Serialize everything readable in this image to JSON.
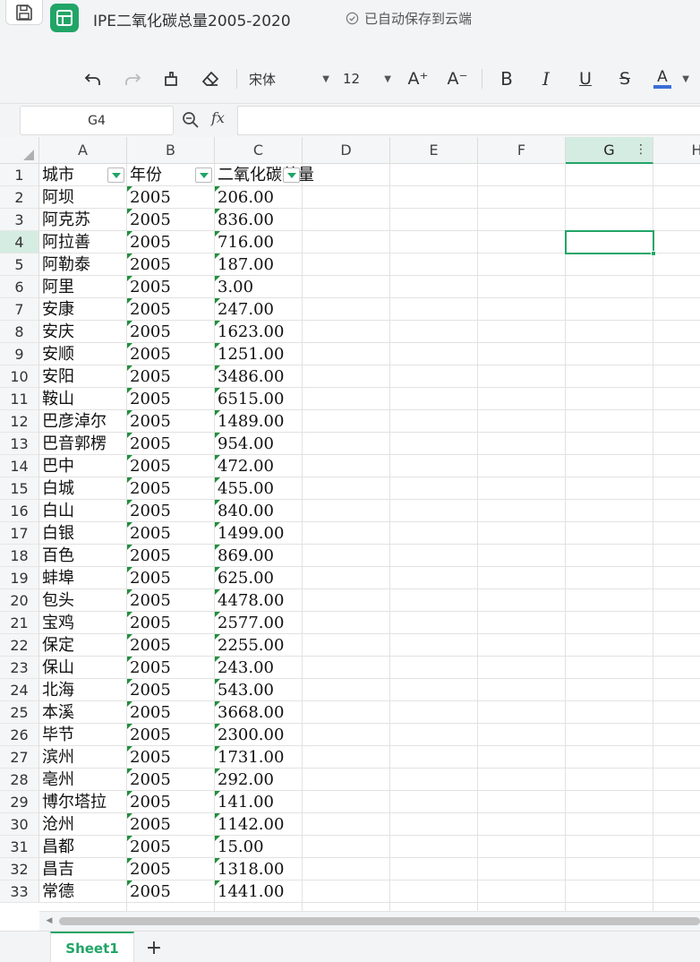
{
  "title_bar": {
    "doc_title": "IPE二氧化碳总量2005-2020",
    "save_status": "已自动保存到云端",
    "save_icon": "save-icon",
    "app_icon": "spreadsheet-app-icon"
  },
  "toolbar": {
    "font_name": "宋体",
    "font_size": "12",
    "increase_font": "A⁺",
    "decrease_font": "A⁻",
    "bold": "B",
    "italic": "I",
    "underline": "U",
    "strike": "S",
    "font_color": "A",
    "font_color_value": "#3a6fd8"
  },
  "formula_bar": {
    "cell_ref": "G4",
    "fx": "fx",
    "formula": ""
  },
  "grid": {
    "columns": [
      "A",
      "B",
      "C",
      "D",
      "E",
      "F",
      "G",
      "H"
    ],
    "active_column": "G",
    "active_row": 4,
    "header_row": [
      "城市",
      "年份",
      "二氧化碳总量"
    ],
    "rows": [
      {
        "row": "2",
        "city": "阿坝",
        "year": "2005",
        "co2": "206.00"
      },
      {
        "row": "3",
        "city": "阿克苏",
        "year": "2005",
        "co2": "836.00"
      },
      {
        "row": "4",
        "city": "阿拉善",
        "year": "2005",
        "co2": "716.00"
      },
      {
        "row": "5",
        "city": "阿勒泰",
        "year": "2005",
        "co2": "187.00"
      },
      {
        "row": "6",
        "city": "阿里",
        "year": "2005",
        "co2": "3.00"
      },
      {
        "row": "7",
        "city": "安康",
        "year": "2005",
        "co2": "247.00"
      },
      {
        "row": "8",
        "city": "安庆",
        "year": "2005",
        "co2": "1623.00"
      },
      {
        "row": "9",
        "city": "安顺",
        "year": "2005",
        "co2": "1251.00"
      },
      {
        "row": "10",
        "city": "安阳",
        "year": "2005",
        "co2": "3486.00"
      },
      {
        "row": "11",
        "city": "鞍山",
        "year": "2005",
        "co2": "6515.00"
      },
      {
        "row": "12",
        "city": "巴彦淖尔",
        "year": "2005",
        "co2": "1489.00"
      },
      {
        "row": "13",
        "city": "巴音郭楞",
        "year": "2005",
        "co2": "954.00"
      },
      {
        "row": "14",
        "city": "巴中",
        "year": "2005",
        "co2": "472.00"
      },
      {
        "row": "15",
        "city": "白城",
        "year": "2005",
        "co2": "455.00"
      },
      {
        "row": "16",
        "city": "白山",
        "year": "2005",
        "co2": "840.00"
      },
      {
        "row": "17",
        "city": "白银",
        "year": "2005",
        "co2": "1499.00"
      },
      {
        "row": "18",
        "city": "百色",
        "year": "2005",
        "co2": "869.00"
      },
      {
        "row": "19",
        "city": "蚌埠",
        "year": "2005",
        "co2": "625.00"
      },
      {
        "row": "20",
        "city": "包头",
        "year": "2005",
        "co2": "4478.00"
      },
      {
        "row": "21",
        "city": "宝鸡",
        "year": "2005",
        "co2": "2577.00"
      },
      {
        "row": "22",
        "city": "保定",
        "year": "2005",
        "co2": "2255.00"
      },
      {
        "row": "23",
        "city": "保山",
        "year": "2005",
        "co2": "243.00"
      },
      {
        "row": "24",
        "city": "北海",
        "year": "2005",
        "co2": "543.00"
      },
      {
        "row": "25",
        "city": "本溪",
        "year": "2005",
        "co2": "3668.00"
      },
      {
        "row": "26",
        "city": "毕节",
        "year": "2005",
        "co2": "2300.00"
      },
      {
        "row": "27",
        "city": "滨州",
        "year": "2005",
        "co2": "1731.00"
      },
      {
        "row": "28",
        "city": "亳州",
        "year": "2005",
        "co2": "292.00"
      },
      {
        "row": "29",
        "city": "博尔塔拉",
        "year": "2005",
        "co2": "141.00"
      },
      {
        "row": "30",
        "city": "沧州",
        "year": "2005",
        "co2": "1142.00"
      },
      {
        "row": "31",
        "city": "昌都",
        "year": "2005",
        "co2": "15.00"
      },
      {
        "row": "32",
        "city": "昌吉",
        "year": "2005",
        "co2": "1318.00"
      },
      {
        "row": "33",
        "city": "常德",
        "year": "2005",
        "co2": "1441.00"
      }
    ]
  },
  "sheet_tabs": {
    "tabs": [
      "Sheet1"
    ],
    "active": "Sheet1",
    "add_label": "+"
  },
  "colors": {
    "accent": "#21a567",
    "number_text_indicator": "#1f8f3a"
  }
}
